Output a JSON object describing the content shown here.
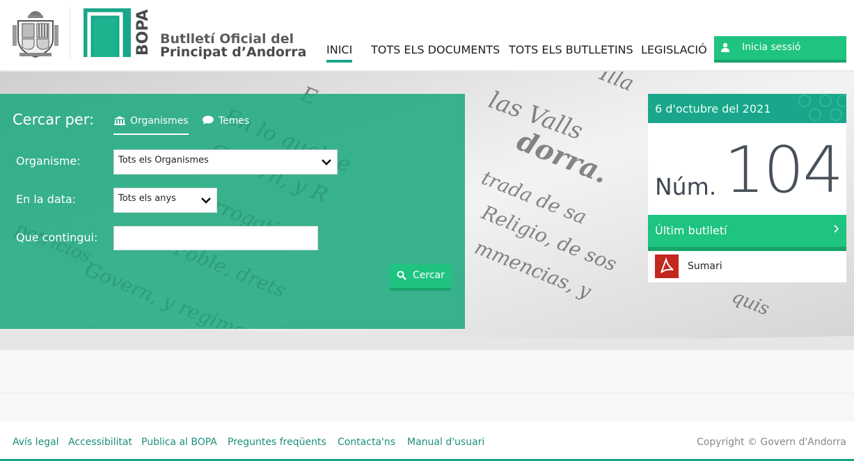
{
  "header": {
    "brand_line1": "Butlletí Oficial del",
    "brand_line2": "Principat d’Andorra",
    "logo_word": "BOPA"
  },
  "nav": {
    "items": [
      {
        "label": "INICI",
        "active": true
      },
      {
        "label": "TOTS ELS DOCUMENTS",
        "active": false
      },
      {
        "label": "TOTS ELS BUTLLETINS",
        "active": false
      },
      {
        "label": "LEGISLACIÓ",
        "active": false
      }
    ],
    "login_label": "Inicia sessió"
  },
  "search": {
    "title": "Cercar per:",
    "tabs": [
      {
        "label": "Organismes",
        "icon": "building-icon",
        "active": true
      },
      {
        "label": "Temes",
        "icon": "speech-bubble-icon",
        "active": false
      }
    ],
    "organisme_label": "Organisme:",
    "organisme_value": "Tots els Organismes",
    "date_label": "En la data:",
    "date_value": "Tots els anys",
    "content_label": "Que contingui:",
    "content_value": "",
    "button_label": "Cercar"
  },
  "bulletin": {
    "date": "6 d'octubre del 2021",
    "num_label": "Núm.",
    "num_value": "104",
    "last_label": "Últim butlletí",
    "sumari_label": "Sumari"
  },
  "footer": {
    "links": [
      "Avís legal",
      "Accessibilitat",
      "Publica al BOPA",
      "Preguntes freqüents",
      "Contacta'ns",
      "Manual d'usuari"
    ],
    "copyright": "Copyright © Govern d'Andorra"
  },
  "colors": {
    "accent": "#1aa68a",
    "button": "#1ec47f",
    "button_shadow": "#17a56a",
    "pdf": "#c4271e"
  }
}
